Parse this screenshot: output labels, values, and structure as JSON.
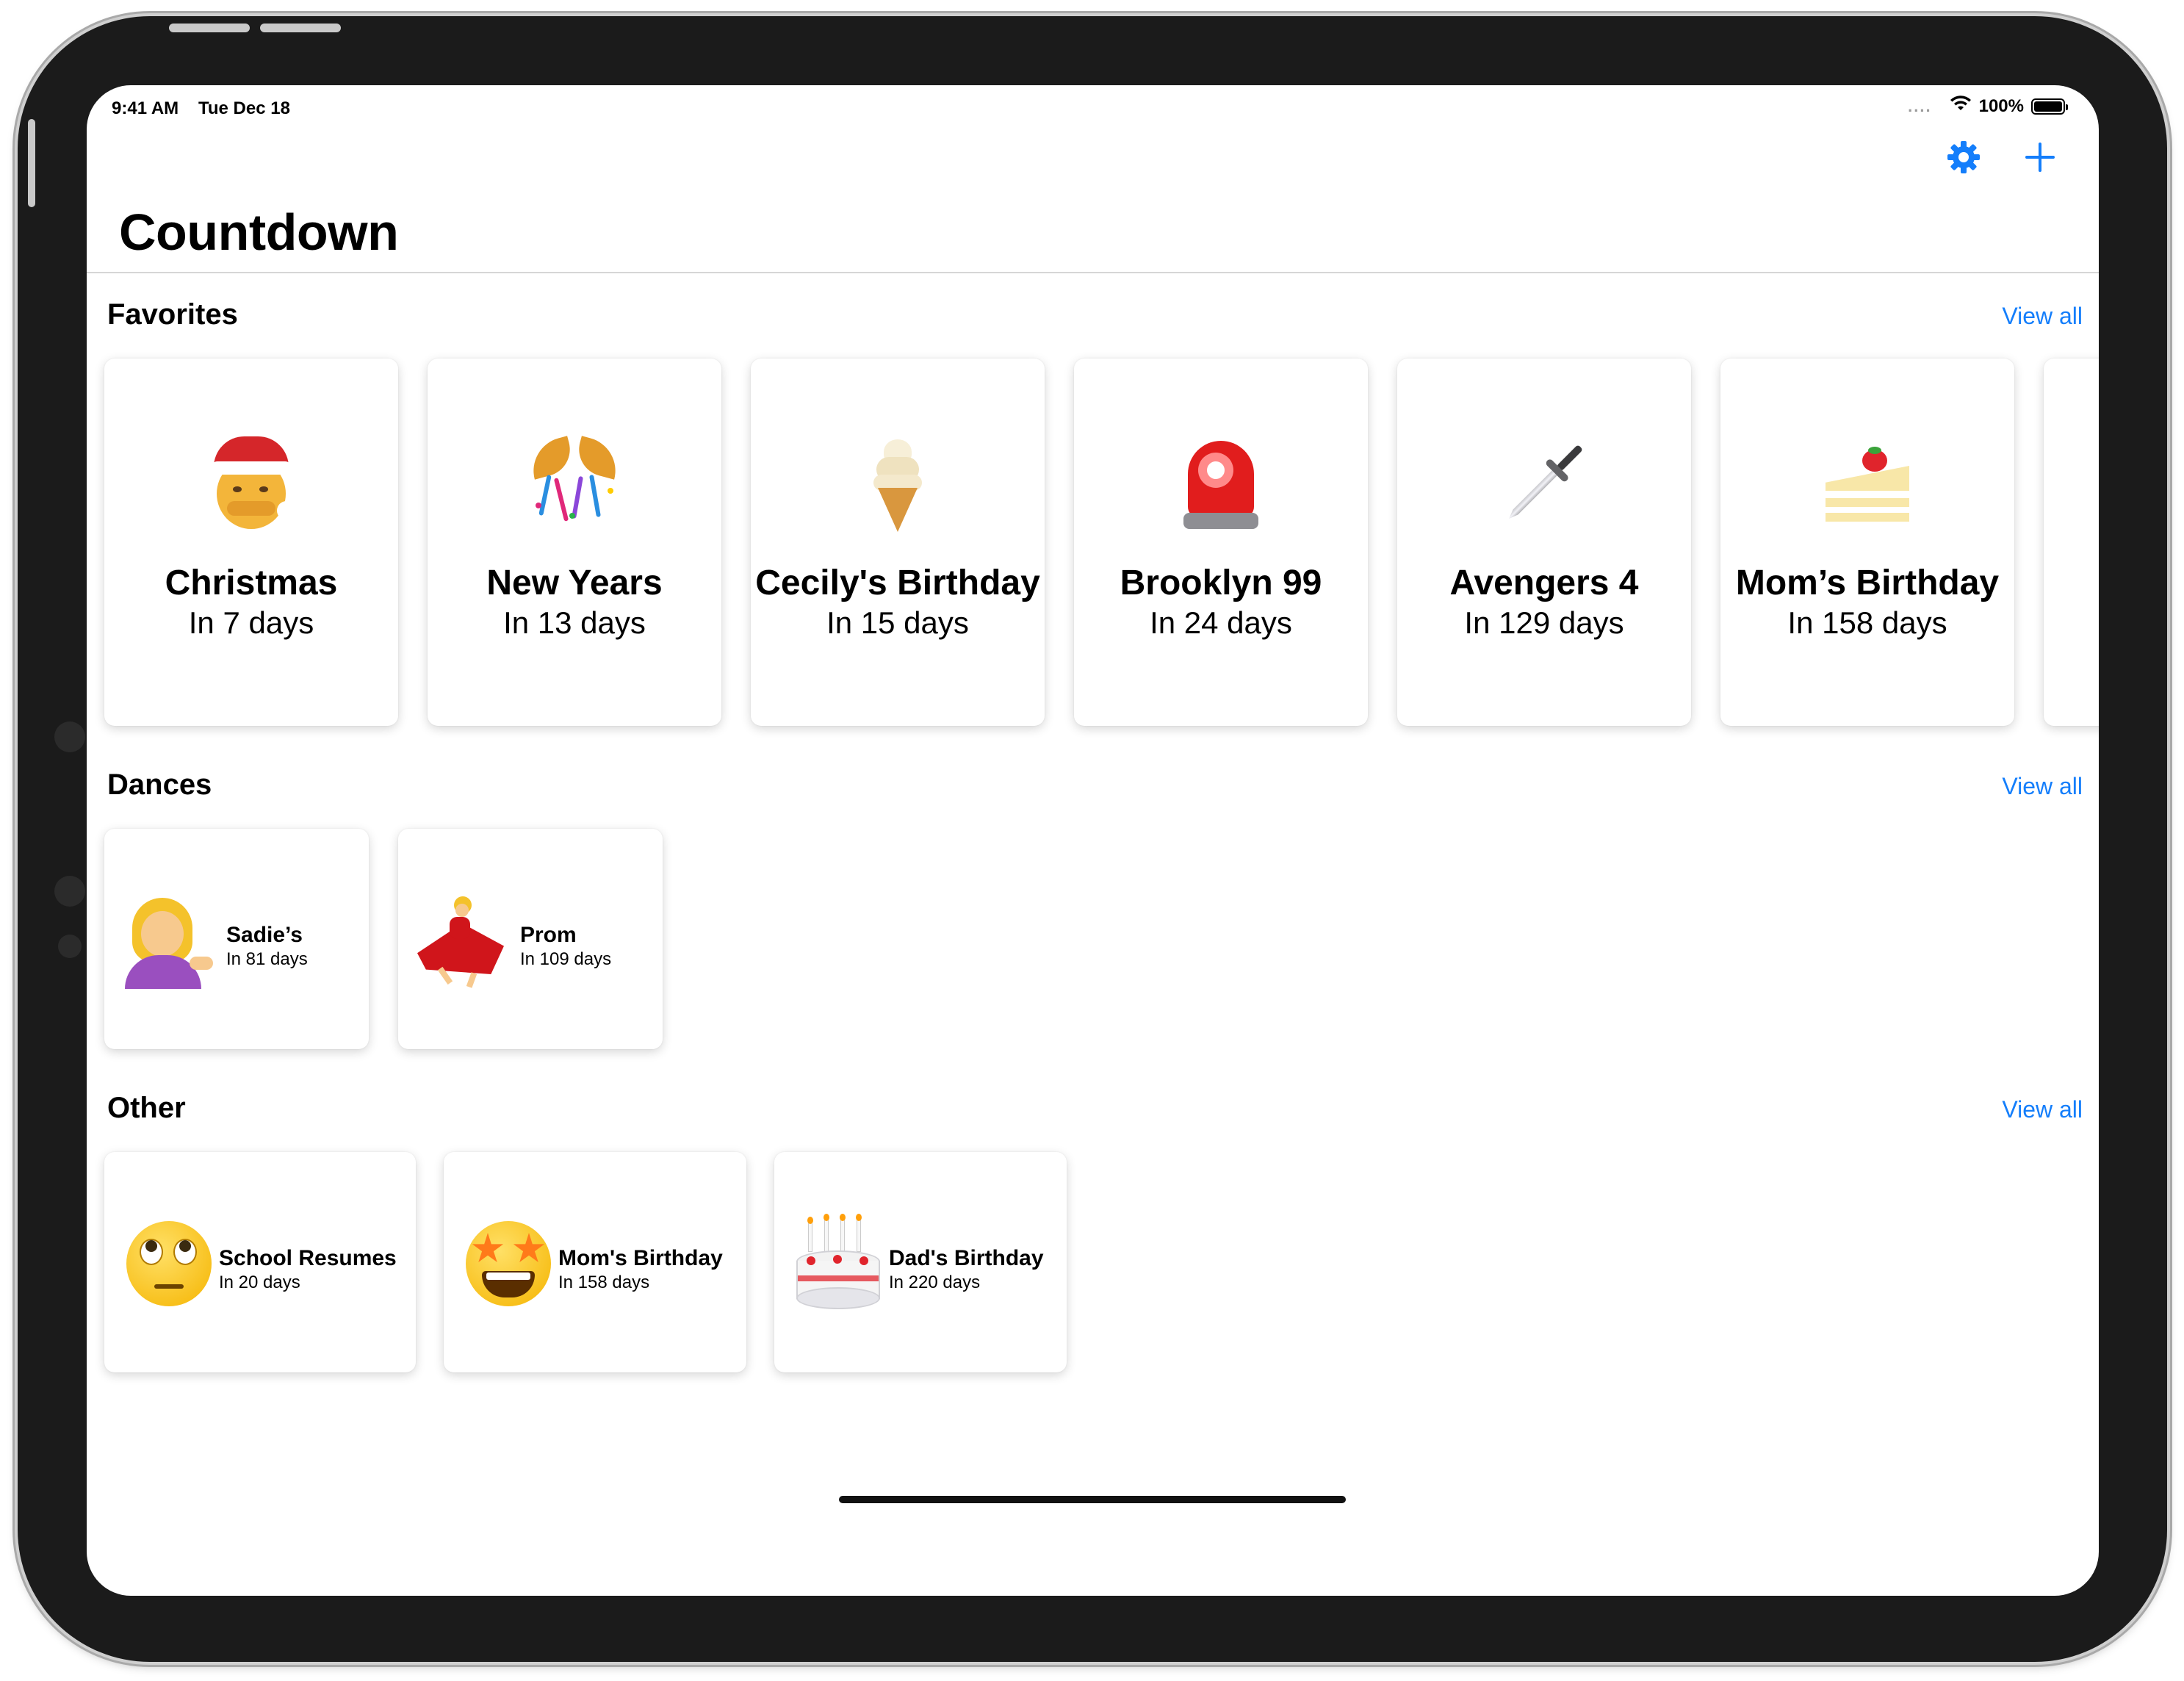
{
  "status_bar": {
    "time": "9:41 AM",
    "date": "Tue Dec 18",
    "battery": "100%",
    "signal_dots": "....",
    "battery_level": 1.0
  },
  "nav": {
    "title": "Countdown",
    "settings_icon": "gear-icon",
    "add_icon": "plus-icon"
  },
  "colors": {
    "accent": "#147efb",
    "card_bg": "#ffffff"
  },
  "sections": [
    {
      "title": "Favorites",
      "view_all": "View all",
      "items": [
        {
          "name": "Christmas",
          "days": "In 7 days",
          "icon": "santa-emoji"
        },
        {
          "name": "New Years",
          "days": "In 13 days",
          "icon": "confetti-ball-emoji"
        },
        {
          "name": "Cecily's Birthday",
          "days": "In 15 days",
          "icon": "soft-ice-cream-emoji"
        },
        {
          "name": "Brooklyn 99",
          "days": "In 24 days",
          "icon": "police-light-emoji"
        },
        {
          "name": "Avengers 4",
          "days": "In 129 days",
          "icon": "dagger-emoji"
        },
        {
          "name": "Mom’s Birthday",
          "days": "In 158 days",
          "icon": "shortcake-emoji"
        }
      ]
    },
    {
      "title": "Dances",
      "view_all": "View all",
      "items": [
        {
          "name": "Sadie’s",
          "days": "In 81 days",
          "icon": "woman-tipping-hand-emoji"
        },
        {
          "name": "Prom",
          "days": "In 109 days",
          "icon": "woman-dancing-emoji"
        }
      ]
    },
    {
      "title": "Other",
      "view_all": "View all",
      "items": [
        {
          "name": "School Resumes",
          "days": "In 20 days",
          "icon": "eye-roll-emoji"
        },
        {
          "name": "Mom's Birthday",
          "days": "In 158 days",
          "icon": "star-struck-emoji"
        },
        {
          "name": "Dad's Birthday",
          "days": "In 220 days",
          "icon": "birthday-cake-emoji"
        }
      ]
    }
  ]
}
